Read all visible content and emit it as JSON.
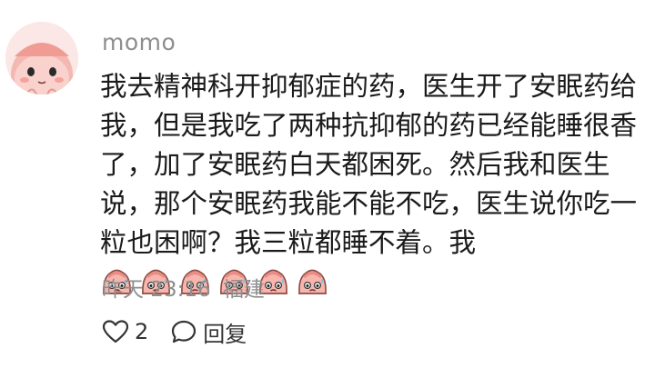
{
  "comment": {
    "username": "momo",
    "text": "我去精神科开抑郁症的药，医生开了安眠药给我，但是我吃了两种抗抑郁的药已经能睡很香了，加了安眠药白天都困死。然后我和医生说，那个安眠药我能不能不吃，医生说你吃一粒也困啊？我三粒都睡不着。我",
    "emoji_count": 6,
    "emoji_icon": "sweating-pink-face-sticker",
    "time": "昨天 23:16",
    "location": "福建",
    "like_count": "2",
    "reply_label": "回复"
  }
}
